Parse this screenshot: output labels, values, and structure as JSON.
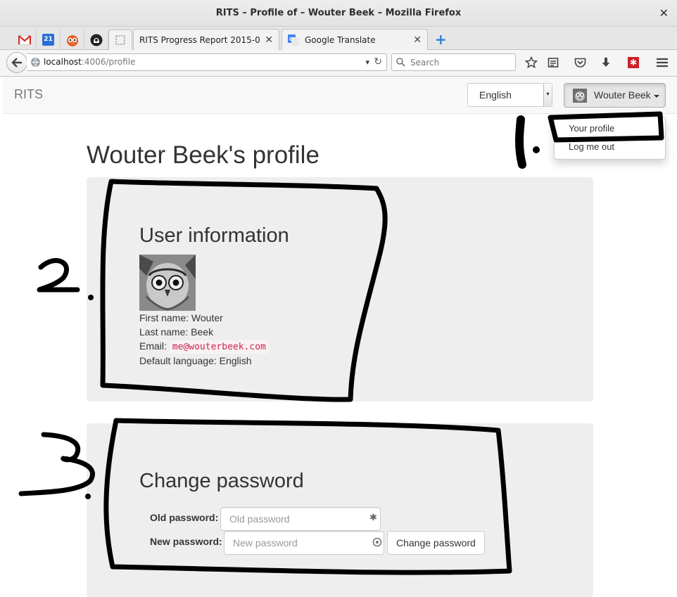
{
  "window": {
    "title": "RITS – Profile of – Wouter Beek – Mozilla Firefox",
    "close_glyph": "✕"
  },
  "tabs": {
    "pinned": [
      {
        "icon": "gmail-icon"
      },
      {
        "icon": "calendar-icon",
        "label": "21"
      },
      {
        "icon": "owl-icon"
      },
      {
        "icon": "github-icon"
      },
      {
        "icon": "blank-page-icon"
      }
    ],
    "open": [
      {
        "label": "RITS Progress Report 2015-0…",
        "close": "✕"
      },
      {
        "label": "Google Translate",
        "close": "✕"
      }
    ],
    "new_tab_glyph": "+"
  },
  "navbar": {
    "url_host": "localhost",
    "url_path": ":4006/profile",
    "url_dropdown_glyph": "▾",
    "reload_glyph": "↻",
    "search_placeholder": "Search",
    "tools": [
      "bookmark-star-icon",
      "reading-list-icon",
      "pocket-icon",
      "download-icon",
      "lastpass-icon",
      "hamburger-menu-icon"
    ]
  },
  "app": {
    "brand": "RITS",
    "language": {
      "selected": "English"
    },
    "user_menu": {
      "label": "Wouter Beek",
      "items": [
        "Your profile",
        "Log me out"
      ]
    },
    "page_title": "Wouter Beek's profile",
    "user_info": {
      "heading": "User information",
      "first_name_label": "First name: ",
      "first_name": "Wouter",
      "last_name_label": "Last name: ",
      "last_name": "Beek",
      "email_label": "Email: ",
      "email": "me@wouterbeek.com",
      "language_label": "Default language: ",
      "language": "English"
    },
    "change_password": {
      "heading": "Change password",
      "old_label": "Old password:",
      "old_placeholder": "Old password",
      "new_label": "New password:",
      "new_placeholder": "New password",
      "submit_label": "Change password"
    }
  },
  "annotations": {
    "marks": [
      "1.",
      "2.",
      "3."
    ]
  },
  "colors": {
    "accent_blue": "#2a7be0",
    "code_red": "#c7254e",
    "panel_bg": "#eeeeee"
  }
}
